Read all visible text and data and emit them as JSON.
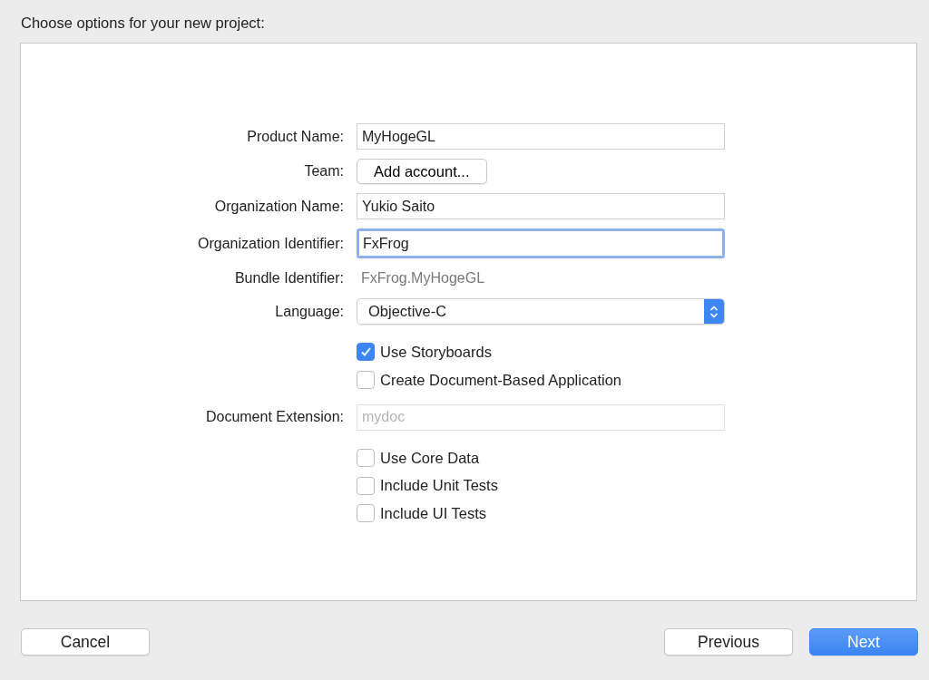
{
  "heading": "Choose options for your new project:",
  "form": [
    {
      "kind": "text-field",
      "label": "Product Name:",
      "value": "MyHogeGL",
      "focused": false
    },
    {
      "kind": "button",
      "label": "Team:",
      "value": "Add account..."
    },
    {
      "kind": "text-field",
      "label": "Organization Name:",
      "value": "Yukio Saito",
      "focused": false
    },
    {
      "kind": "text-field",
      "label": "Organization Identifier:",
      "value": "FxFrog",
      "focused": true
    },
    {
      "kind": "static",
      "label": "Bundle Identifier:",
      "value": "FxFrog.MyHogeGL"
    },
    {
      "kind": "popup",
      "label": "Language:",
      "value": "Objective-C"
    },
    {
      "kind": "checkbox",
      "text": "Use Storyboards",
      "checked": true
    },
    {
      "kind": "checkbox",
      "text": "Create Document-Based Application",
      "checked": false
    },
    {
      "kind": "disabled-field",
      "label": "Document Extension:",
      "placeholder": "mydoc"
    },
    {
      "kind": "checkbox",
      "text": "Use Core Data",
      "checked": false
    },
    {
      "kind": "checkbox",
      "text": "Include Unit Tests",
      "checked": false
    },
    {
      "kind": "checkbox",
      "text": "Include UI Tests",
      "checked": false
    }
  ],
  "buttons_left": [
    {
      "label": "Cancel",
      "default": false
    }
  ],
  "buttons_right": [
    {
      "label": "Previous",
      "default": false
    },
    {
      "label": "Next",
      "default": true
    }
  ]
}
